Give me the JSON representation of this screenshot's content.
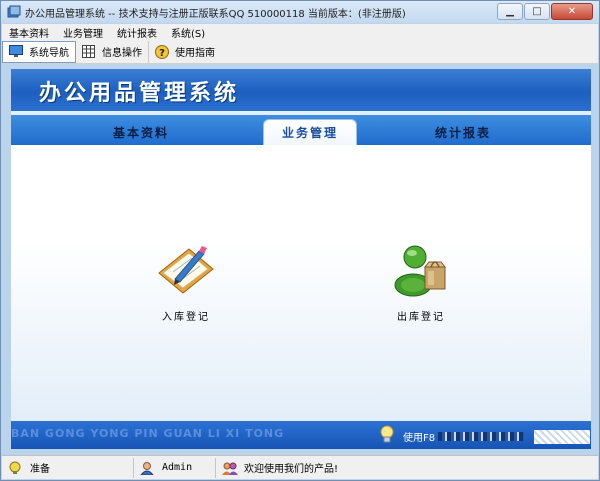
{
  "window": {
    "title": "办公用品管理系统 -- 技术支持与注册正版联系QQ 510000118   当前版本：(非注册版)",
    "minimize_icon": "minimize-icon",
    "maximize_icon": "maximize-icon",
    "close_icon": "close-icon"
  },
  "menubar": {
    "items": [
      {
        "label": "基本资料"
      },
      {
        "label": "业务管理"
      },
      {
        "label": "统计报表"
      },
      {
        "label": "系统(S)"
      }
    ]
  },
  "toolbar": {
    "buttons": [
      {
        "label": "系统导航",
        "icon": "monitor-icon",
        "active": true
      },
      {
        "label": "信息操作",
        "icon": "table-icon",
        "active": false
      },
      {
        "label": "使用指南",
        "icon": "help-icon",
        "active": false
      }
    ]
  },
  "banner": {
    "title": "办公用品管理系统"
  },
  "tabs": [
    {
      "label": "基本资料",
      "active": false
    },
    {
      "label": "业务管理",
      "active": true
    },
    {
      "label": "统计报表",
      "active": false
    }
  ],
  "modules": [
    {
      "label": "入库登记",
      "icon": "clipboard-pen-icon"
    },
    {
      "label": "出库登记",
      "icon": "person-bag-icon"
    }
  ],
  "footer": {
    "pinyin": "BAN GONG YONG PIN GUAN LI XI TONG",
    "hint": "使用F8",
    "hint_icon": "lightbulb-icon"
  },
  "statusbar": {
    "ready": "准备",
    "user": "Admin",
    "welcome": "欢迎使用我们的产品!"
  },
  "colors": {
    "banner": "#1d5fbf",
    "tabbar": "#2f7bd6",
    "active_tab_text": "#1a4fa0"
  }
}
